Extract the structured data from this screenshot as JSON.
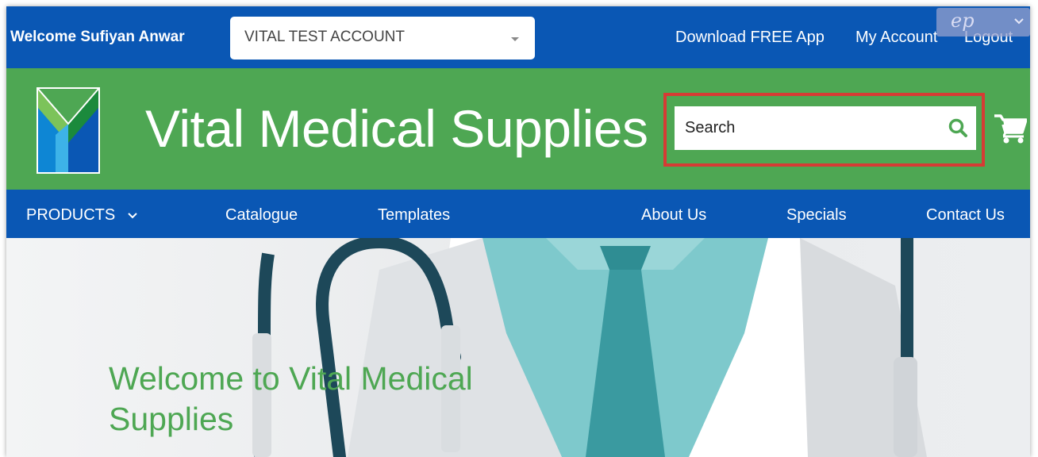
{
  "topbar": {
    "welcome": "Welcome Sufiyan Anwar",
    "account_select": "VITAL TEST ACCOUNT",
    "download_app": "Download FREE App",
    "my_account": "My Account",
    "logout": "Logout"
  },
  "header": {
    "site_title": "Vital Medical Supplies",
    "search_placeholder": "Search"
  },
  "nav": {
    "products": "PRODUCTS",
    "catalogue": "Catalogue",
    "templates": "Templates",
    "about": "About Us",
    "specials": "Specials",
    "contact": "Contact Us"
  },
  "hero": {
    "title": "Welcome to Vital Medical Supplies"
  },
  "colors": {
    "brand_blue": "#0a57b4",
    "brand_green": "#4ea753",
    "highlight_red": "#d63b34"
  },
  "icons": [
    "chevron-down-icon",
    "search-icon",
    "cart-icon",
    "logo-icon",
    "extension-signature-icon"
  ]
}
